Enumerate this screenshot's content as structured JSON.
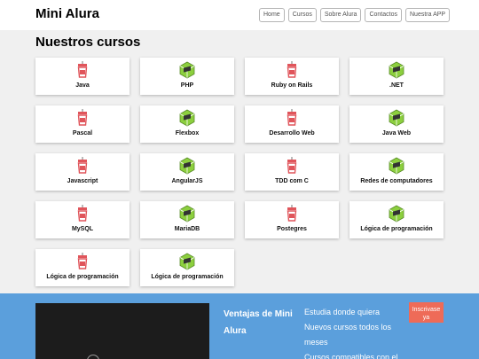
{
  "header": {
    "logo": "Mini Alura",
    "nav": [
      "Home",
      "Cursos",
      "Sobre Alura",
      "Contactos",
      "Nuestra APP"
    ]
  },
  "main": {
    "title": "Nuestros cursos",
    "courses": [
      {
        "label": "Java",
        "icon": "jar-icon"
      },
      {
        "label": "PHP",
        "icon": "cube-icon"
      },
      {
        "label": "Ruby on Rails",
        "icon": "jar-icon"
      },
      {
        "label": ".NET",
        "icon": "cube-icon"
      },
      {
        "label": "Pascal",
        "icon": "jar-icon"
      },
      {
        "label": "Flexbox",
        "icon": "cube-icon"
      },
      {
        "label": "Desarrollo Web",
        "icon": "jar-icon"
      },
      {
        "label": "Java Web",
        "icon": "cube-icon"
      },
      {
        "label": "Javascript",
        "icon": "jar-icon"
      },
      {
        "label": "AngularJS",
        "icon": "cube-icon"
      },
      {
        "label": "TDD com C",
        "icon": "jar-icon"
      },
      {
        "label": "Redes de computadores",
        "icon": "cube-icon"
      },
      {
        "label": "MySQL",
        "icon": "jar-icon"
      },
      {
        "label": "MariaDB",
        "icon": "cube-icon"
      },
      {
        "label": "Postegres",
        "icon": "jar-icon"
      },
      {
        "label": "Lógica de programación",
        "icon": "cube-icon"
      },
      {
        "label": "Lógica de programación",
        "icon": "jar-icon"
      },
      {
        "label": "Lógica de programación",
        "icon": "cube-icon"
      }
    ]
  },
  "footer": {
    "ventajas_title": "Ventajas de Mini Alura",
    "benefits": [
      "Estudia donde quiera",
      "Nuevos cursos todos los meses",
      "Cursos compatibles con el"
    ],
    "cta_label": "Inscrivase ya"
  },
  "colors": {
    "footer_bg": "#5b9fdc",
    "cta_bg": "#ee6b58",
    "jar_red": "#e0555b",
    "cube_green": "#8ccf3e"
  }
}
